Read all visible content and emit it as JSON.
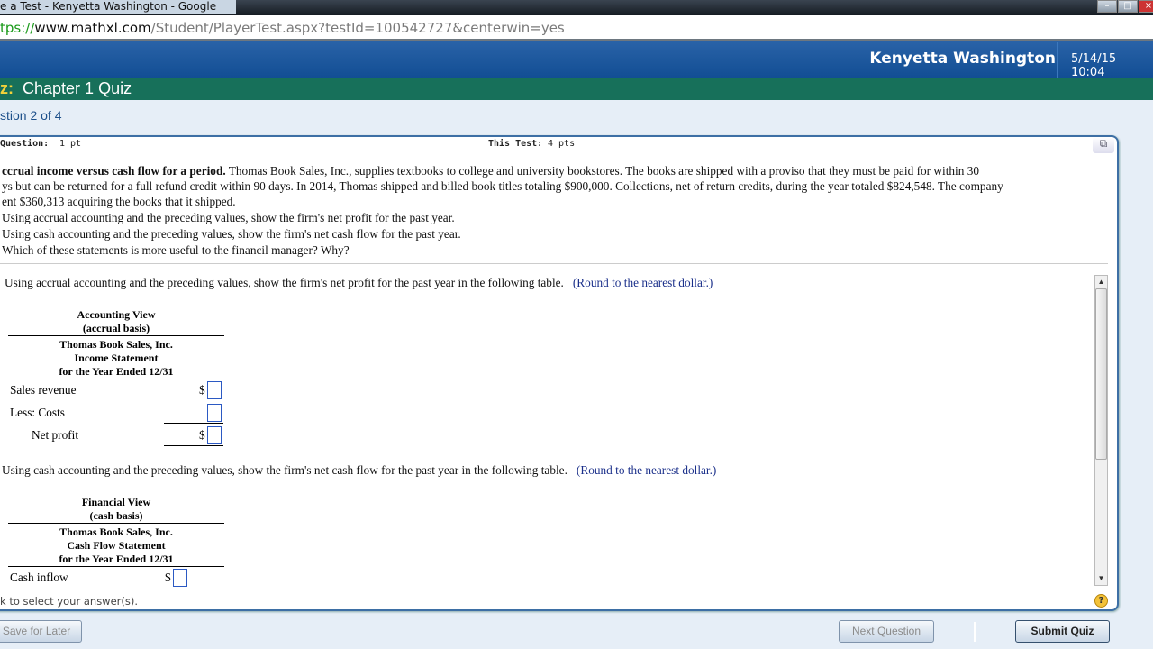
{
  "browser": {
    "title": "e a Test - Kenyetta Washington - Google Chrome",
    "url_scheme": "tps://",
    "url_domain": "www.mathxl.com",
    "url_path": "/Student/PlayerTest.aspx?testId=100542727&centerwin=yes"
  },
  "header": {
    "user": "Kenyetta Washington",
    "datetime": "5/14/15 10:04"
  },
  "quiz": {
    "prefix": "z:",
    "title": "Chapter 1 Quiz",
    "question_nav": "stion 2 of 4"
  },
  "panel": {
    "question_label": "Question:",
    "question_points": "1 pt",
    "test_label": "This Test:",
    "test_points": "4 pts"
  },
  "question": {
    "lines": [
      {
        "bold": "ccrual income versus cash flow for a period.",
        "text": "  Thomas Book Sales, Inc., supplies textbooks to college and university bookstores.  The books are shipped with a proviso that they must be paid for within 30"
      },
      {
        "bold": "",
        "text": "ys but can be returned for a full refund credit within 90 days.  In 2014, Thomas shipped and billed book titles totaling $900,000.  Collections, net of return credits, during the year totaled $824,548.  The company"
      },
      {
        "bold": "",
        "text": "ent $360,313 acquiring the books that it shipped."
      },
      {
        "bold": "",
        "text": " Using accrual accounting and the preceding values, show the firm's net profit for the past year."
      },
      {
        "bold": "",
        "text": " Using cash accounting and the preceding values, show the firm's net cash flow for the past year."
      },
      {
        "bold": "",
        "text": " Which of these statements is more useful to the financil manager? Why?"
      }
    ]
  },
  "part_a": {
    "prompt": "Using accrual accounting and the preceding values, show the firm's net profit for the past year in the following table.",
    "hint": "(Round to the nearest dollar.)",
    "view": "Accounting View",
    "basis": "(accrual basis)",
    "company": "Thomas Book Sales, Inc.",
    "statement": "Income Statement",
    "period": "for the Year Ended 12/31",
    "rows": [
      {
        "label": "Sales revenue",
        "prefix": "$",
        "value": ""
      },
      {
        "label": "Less:  Costs",
        "prefix": "",
        "value": ""
      },
      {
        "label": "Net profit",
        "prefix": "$",
        "value": ""
      }
    ]
  },
  "part_b": {
    "prompt": "Using cash accounting and the preceding values, show the firm's net cash flow for the past year in the following table.",
    "hint": "(Round to the nearest dollar.)",
    "view": "Financial View",
    "basis": "(cash basis)",
    "company": "Thomas Book Sales, Inc.",
    "statement": "Cash Flow Statement",
    "period": "for the Year Ended 12/31",
    "rows": [
      {
        "label": "Cash inflow",
        "prefix": "$",
        "value": ""
      }
    ]
  },
  "footer": {
    "instruction": "k to select your answer(s).",
    "help": "?"
  },
  "buttons": {
    "save": "Save for Later",
    "next": "Next Question",
    "submit": "Submit Quiz"
  }
}
